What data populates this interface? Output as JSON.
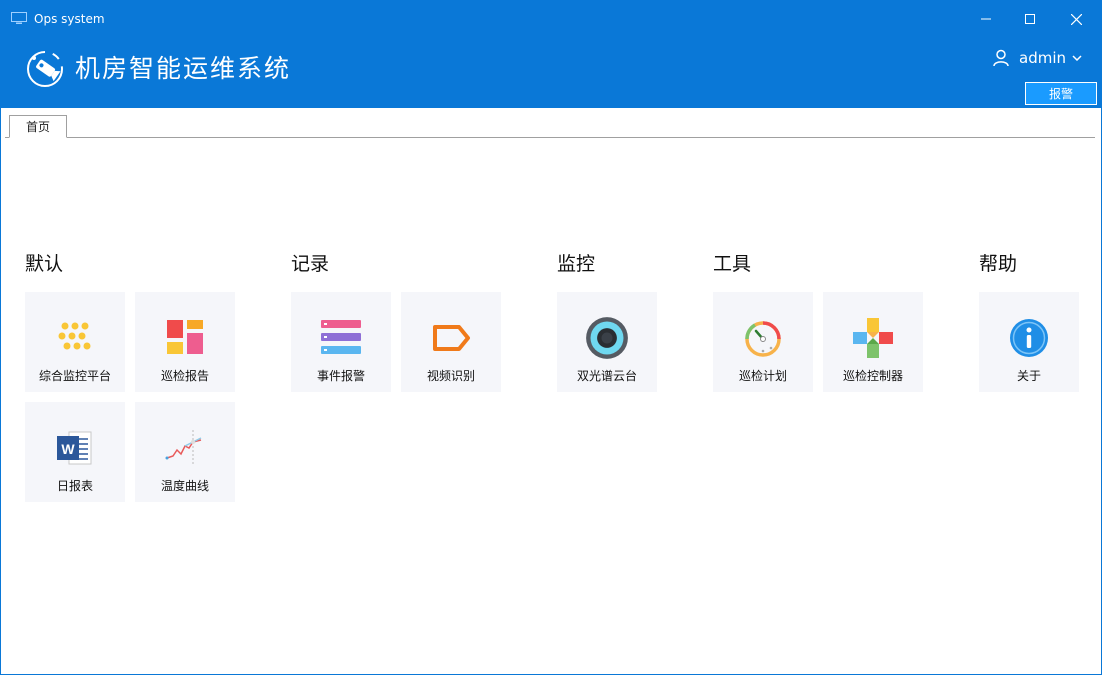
{
  "window": {
    "title": "Ops system"
  },
  "header": {
    "app_name": "机房智能运维系统",
    "user": "admin",
    "alarm_label": "报警"
  },
  "tabs": [
    {
      "label": "首页"
    }
  ],
  "sections": [
    {
      "title": "默认",
      "items": [
        {
          "label": "综合监控平台",
          "icon": "dots-grid-icon"
        },
        {
          "label": "巡检报告",
          "icon": "report-blocks-icon"
        },
        {
          "label": "日报表",
          "icon": "word-document-icon"
        },
        {
          "label": "温度曲线",
          "icon": "line-chart-icon"
        }
      ]
    },
    {
      "title": "记录",
      "items": [
        {
          "label": "事件报警",
          "icon": "event-list-icon"
        },
        {
          "label": "视频识别",
          "icon": "tag-outline-icon"
        }
      ]
    },
    {
      "title": "监控",
      "items": [
        {
          "label": "双光谱云台",
          "icon": "camera-lens-icon"
        }
      ]
    },
    {
      "title": "工具",
      "items": [
        {
          "label": "巡检计划",
          "icon": "clock-plan-icon"
        },
        {
          "label": "巡检控制器",
          "icon": "gamepad-cross-icon"
        }
      ]
    },
    {
      "title": "帮助",
      "items": [
        {
          "label": "关于",
          "icon": "info-circle-icon"
        }
      ]
    }
  ],
  "colors": {
    "titlebar": "#0a78d7",
    "alarm_button": "#1a9bff",
    "tile_bg": "#f5f6fa"
  }
}
